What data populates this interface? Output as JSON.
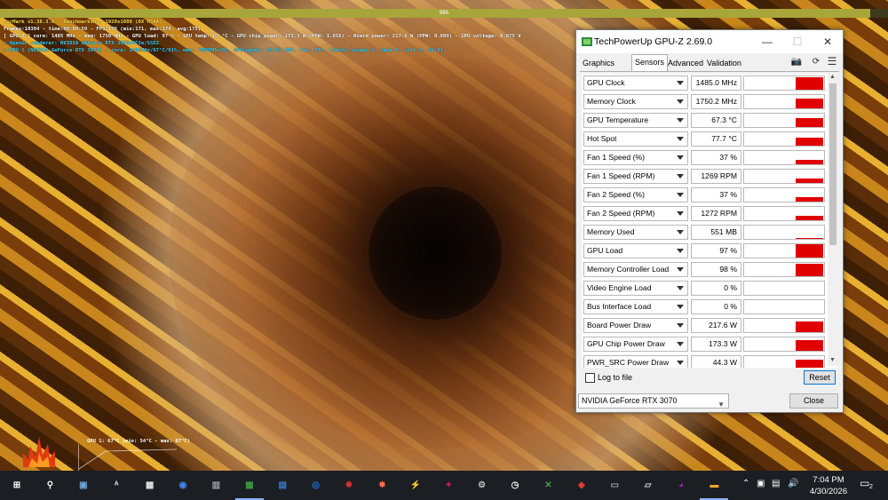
{
  "furmark": {
    "progress_text": "98%",
    "progress_fraction": 0.98,
    "lines": [
      "FurMark v1.38.3.0 - Benchmarking, 1920x1080 (8X MSAA)",
      "Frames:10394 - time:00:00:59 - FPS:176 (min:171, max:179, avg:175)",
      "[ GPU-Z ] core: 1485 MHz - mem: 1750 MHz - GPU load: 97 % - GPU temp: 67 °C - GPU chip power: 173.3 W (PPW: 1.016) - Board power: 217.6 W (PPW: 0.809) - GPU voltage: 0.875 V",
      "> OpenGL renderer: NVIDIA GeForce RTX 3070/PCIe/SSE2",
      "> GPU 1 (NVIDIA GeForce RTX 3070) - core: 1485MHz/67°C/91%, mem: 7000MHz/6%, GPU power: 93.8% TDP, fan: 37%, limits:[power:1, temp:0, volt:0, OV:0]"
    ],
    "temp_graph_label": "GPU 1: 67°C (min: 54°C - max: 67°C)"
  },
  "gpuz": {
    "title": "TechPowerUp GPU-Z 2.69.0",
    "tabs": [
      "Graphics Card",
      "Sensors",
      "Advanced",
      "Validation"
    ],
    "active_tab": "Sensors",
    "sensors": [
      {
        "name": "GPU Clock",
        "value": "1485.0 MHz",
        "level": 0.9
      },
      {
        "name": "Memory Clock",
        "value": "1750.2 MHz",
        "level": 0.7
      },
      {
        "name": "GPU Temperature",
        "value": "67.3 °C",
        "level": 0.65
      },
      {
        "name": "Hot Spot",
        "value": "77.7 °C",
        "level": 0.6
      },
      {
        "name": "Fan 1 Speed (%)",
        "value": "37 %",
        "level": 0.3
      },
      {
        "name": "Fan 1 Speed (RPM)",
        "value": "1269 RPM",
        "level": 0.3
      },
      {
        "name": "Fan 2 Speed (%)",
        "value": "37 %",
        "level": 0.3
      },
      {
        "name": "Fan 2 Speed (RPM)",
        "value": "1272 RPM",
        "level": 0.3
      },
      {
        "name": "Memory Used",
        "value": "551 MB",
        "level": 0.08
      },
      {
        "name": "GPU Load",
        "value": "97 %",
        "level": 0.97
      },
      {
        "name": "Memory Controller Load",
        "value": "98 %",
        "level": 0.95
      },
      {
        "name": "Video Engine Load",
        "value": "0 %",
        "level": 0
      },
      {
        "name": "Bus Interface Load",
        "value": "0 %",
        "level": 0
      },
      {
        "name": "Board Power Draw",
        "value": "217.6 W",
        "level": 0.8
      },
      {
        "name": "GPU Chip Power Draw",
        "value": "173.3 W",
        "level": 0.8
      },
      {
        "name": "PWR_SRC Power Draw",
        "value": "44.3 W",
        "level": 0.75
      }
    ],
    "log_to_file_label": "Log to file",
    "log_to_file_checked": false,
    "reset_label": "Reset",
    "gpu_select_value": "NVIDIA GeForce RTX 3070",
    "close_label": "Close",
    "graph_color": "#e00000"
  },
  "taskbar": {
    "time": "7:04 PM",
    "date": "4/30/2026",
    "notification_count": "2",
    "apps": [
      "start",
      "search",
      "file-explorer-scan",
      "amd",
      "dou",
      "chrome",
      "gpu-tool",
      "gpuz",
      "task-manager",
      "cinebench",
      "furmark",
      "burn-in",
      "msi-afterburner",
      "hwinfo",
      "gear-tool",
      "clock-tool",
      "xbox",
      "3dmark",
      "device-tool",
      "network-tool",
      "color-tool",
      "folder"
    ]
  }
}
